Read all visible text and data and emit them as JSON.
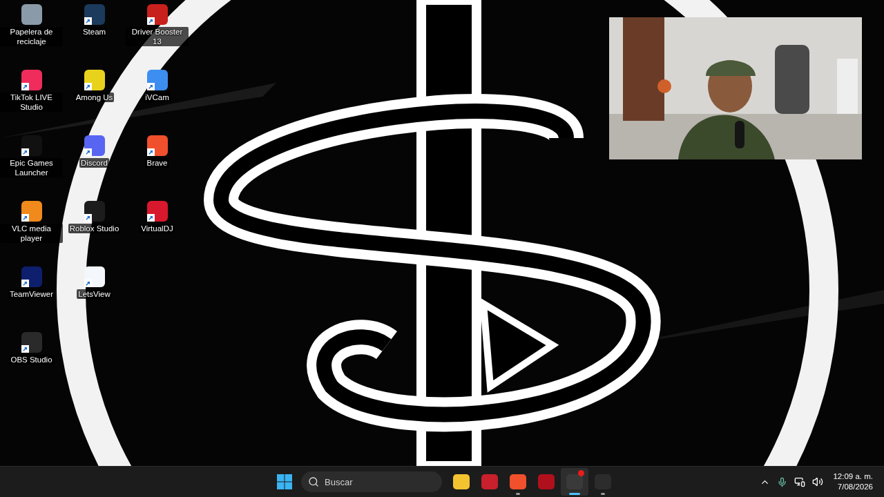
{
  "desktop": {
    "columns": [
      [
        {
          "label": "Papelera de reciclaje",
          "color": "#8a9aa8",
          "shortcut": false
        },
        {
          "label": "TikTok LIVE Studio",
          "color": "#f02c5c",
          "shortcut": true
        },
        {
          "label": "Epic Games Launcher",
          "color": "#111111",
          "shortcut": true
        },
        {
          "label": "VLC media player",
          "color": "#f08a1c",
          "shortcut": true
        },
        {
          "label": "TeamViewer",
          "color": "#0e1f6e",
          "shortcut": true
        },
        {
          "label": "OBS Studio",
          "color": "#2a2a2a",
          "shortcut": true
        }
      ],
      [
        {
          "label": "Steam",
          "color": "#1b3a5c",
          "shortcut": true
        },
        {
          "label": "Among Us",
          "color": "#e8d21c",
          "shortcut": true
        },
        {
          "label": "Discord",
          "color": "#5865f2",
          "shortcut": true
        },
        {
          "label": "Roblox Studio",
          "color": "#1c1c1c",
          "shortcut": true
        },
        {
          "label": "LetsView",
          "color": "#f4f8fc",
          "shortcut": true
        }
      ],
      [
        {
          "label": "Driver Booster 13",
          "color": "#c8201c",
          "shortcut": true
        },
        {
          "label": "iVCam",
          "color": "#3c8ef0",
          "shortcut": true
        },
        {
          "label": "Brave",
          "color": "#f0502c",
          "shortcut": true
        },
        {
          "label": "VirtualDJ",
          "color": "#d8182c",
          "shortcut": true
        }
      ]
    ]
  },
  "taskbar": {
    "search": {
      "placeholder": "Buscar"
    },
    "apps": [
      {
        "color": "#f4c430",
        "running": false,
        "selected": false,
        "badge": false
      },
      {
        "color": "#c8202c",
        "running": false,
        "selected": false,
        "badge": false
      },
      {
        "color": "#f0502c",
        "running": true,
        "selected": false,
        "badge": false
      },
      {
        "color": "#b0101c",
        "running": false,
        "selected": false,
        "badge": false
      },
      {
        "color": "#3a3a3a",
        "running": true,
        "selected": true,
        "badge": true
      },
      {
        "color": "#2c2c2c",
        "running": true,
        "selected": false,
        "badge": false
      }
    ],
    "clock": {
      "time": "12:09 a. m.",
      "date": "7/08/2026"
    }
  }
}
